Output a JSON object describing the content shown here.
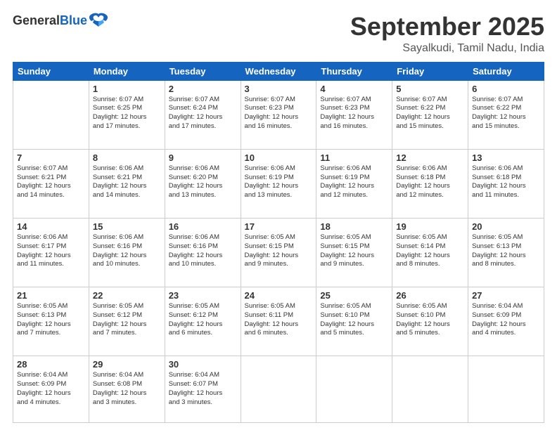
{
  "logo": {
    "general": "General",
    "blue": "Blue"
  },
  "title": "September 2025",
  "location": "Sayalkudi, Tamil Nadu, India",
  "days": [
    "Sunday",
    "Monday",
    "Tuesday",
    "Wednesday",
    "Thursday",
    "Friday",
    "Saturday"
  ],
  "weeks": [
    [
      {
        "day": "",
        "info": ""
      },
      {
        "day": "1",
        "info": "Sunrise: 6:07 AM\nSunset: 6:25 PM\nDaylight: 12 hours\nand 17 minutes."
      },
      {
        "day": "2",
        "info": "Sunrise: 6:07 AM\nSunset: 6:24 PM\nDaylight: 12 hours\nand 17 minutes."
      },
      {
        "day": "3",
        "info": "Sunrise: 6:07 AM\nSunset: 6:23 PM\nDaylight: 12 hours\nand 16 minutes."
      },
      {
        "day": "4",
        "info": "Sunrise: 6:07 AM\nSunset: 6:23 PM\nDaylight: 12 hours\nand 16 minutes."
      },
      {
        "day": "5",
        "info": "Sunrise: 6:07 AM\nSunset: 6:22 PM\nDaylight: 12 hours\nand 15 minutes."
      },
      {
        "day": "6",
        "info": "Sunrise: 6:07 AM\nSunset: 6:22 PM\nDaylight: 12 hours\nand 15 minutes."
      }
    ],
    [
      {
        "day": "7",
        "info": "Sunrise: 6:07 AM\nSunset: 6:21 PM\nDaylight: 12 hours\nand 14 minutes."
      },
      {
        "day": "8",
        "info": "Sunrise: 6:06 AM\nSunset: 6:21 PM\nDaylight: 12 hours\nand 14 minutes."
      },
      {
        "day": "9",
        "info": "Sunrise: 6:06 AM\nSunset: 6:20 PM\nDaylight: 12 hours\nand 13 minutes."
      },
      {
        "day": "10",
        "info": "Sunrise: 6:06 AM\nSunset: 6:19 PM\nDaylight: 12 hours\nand 13 minutes."
      },
      {
        "day": "11",
        "info": "Sunrise: 6:06 AM\nSunset: 6:19 PM\nDaylight: 12 hours\nand 12 minutes."
      },
      {
        "day": "12",
        "info": "Sunrise: 6:06 AM\nSunset: 6:18 PM\nDaylight: 12 hours\nand 12 minutes."
      },
      {
        "day": "13",
        "info": "Sunrise: 6:06 AM\nSunset: 6:18 PM\nDaylight: 12 hours\nand 11 minutes."
      }
    ],
    [
      {
        "day": "14",
        "info": "Sunrise: 6:06 AM\nSunset: 6:17 PM\nDaylight: 12 hours\nand 11 minutes."
      },
      {
        "day": "15",
        "info": "Sunrise: 6:06 AM\nSunset: 6:16 PM\nDaylight: 12 hours\nand 10 minutes."
      },
      {
        "day": "16",
        "info": "Sunrise: 6:06 AM\nSunset: 6:16 PM\nDaylight: 12 hours\nand 10 minutes."
      },
      {
        "day": "17",
        "info": "Sunrise: 6:05 AM\nSunset: 6:15 PM\nDaylight: 12 hours\nand 9 minutes."
      },
      {
        "day": "18",
        "info": "Sunrise: 6:05 AM\nSunset: 6:15 PM\nDaylight: 12 hours\nand 9 minutes."
      },
      {
        "day": "19",
        "info": "Sunrise: 6:05 AM\nSunset: 6:14 PM\nDaylight: 12 hours\nand 8 minutes."
      },
      {
        "day": "20",
        "info": "Sunrise: 6:05 AM\nSunset: 6:13 PM\nDaylight: 12 hours\nand 8 minutes."
      }
    ],
    [
      {
        "day": "21",
        "info": "Sunrise: 6:05 AM\nSunset: 6:13 PM\nDaylight: 12 hours\nand 7 minutes."
      },
      {
        "day": "22",
        "info": "Sunrise: 6:05 AM\nSunset: 6:12 PM\nDaylight: 12 hours\nand 7 minutes."
      },
      {
        "day": "23",
        "info": "Sunrise: 6:05 AM\nSunset: 6:12 PM\nDaylight: 12 hours\nand 6 minutes."
      },
      {
        "day": "24",
        "info": "Sunrise: 6:05 AM\nSunset: 6:11 PM\nDaylight: 12 hours\nand 6 minutes."
      },
      {
        "day": "25",
        "info": "Sunrise: 6:05 AM\nSunset: 6:10 PM\nDaylight: 12 hours\nand 5 minutes."
      },
      {
        "day": "26",
        "info": "Sunrise: 6:05 AM\nSunset: 6:10 PM\nDaylight: 12 hours\nand 5 minutes."
      },
      {
        "day": "27",
        "info": "Sunrise: 6:04 AM\nSunset: 6:09 PM\nDaylight: 12 hours\nand 4 minutes."
      }
    ],
    [
      {
        "day": "28",
        "info": "Sunrise: 6:04 AM\nSunset: 6:09 PM\nDaylight: 12 hours\nand 4 minutes."
      },
      {
        "day": "29",
        "info": "Sunrise: 6:04 AM\nSunset: 6:08 PM\nDaylight: 12 hours\nand 3 minutes."
      },
      {
        "day": "30",
        "info": "Sunrise: 6:04 AM\nSunset: 6:07 PM\nDaylight: 12 hours\nand 3 minutes."
      },
      {
        "day": "",
        "info": ""
      },
      {
        "day": "",
        "info": ""
      },
      {
        "day": "",
        "info": ""
      },
      {
        "day": "",
        "info": ""
      }
    ]
  ]
}
